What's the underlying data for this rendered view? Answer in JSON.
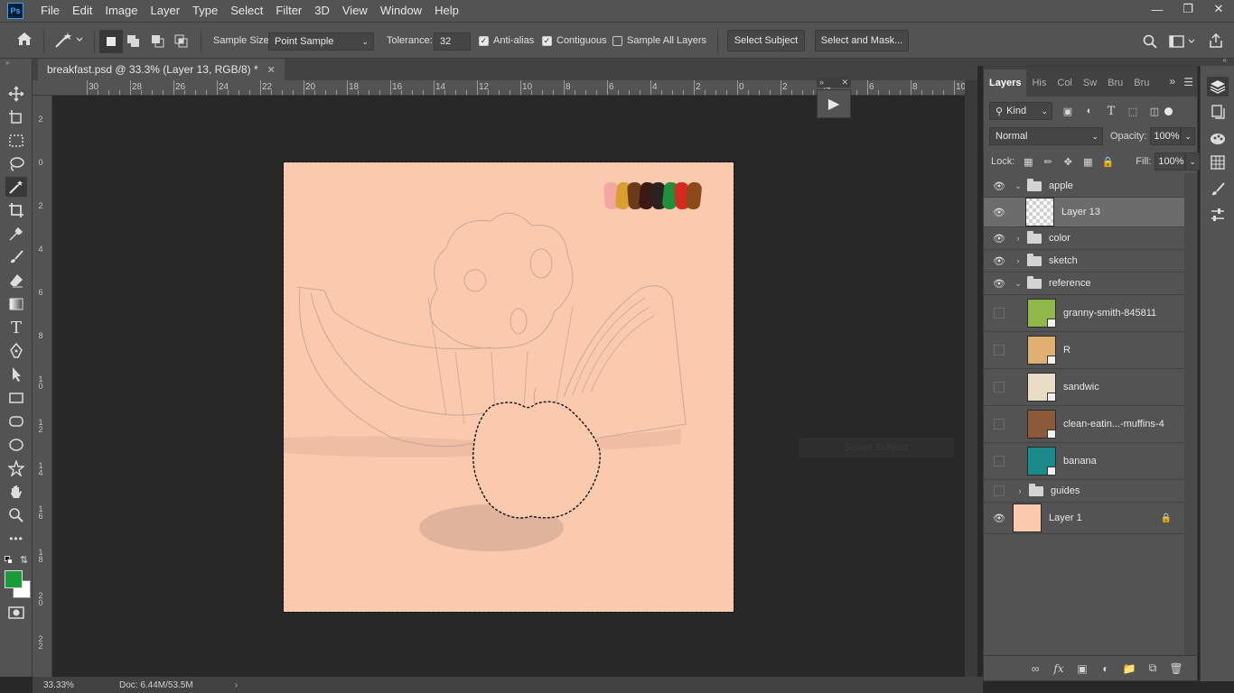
{
  "app": {
    "logo": "Ps",
    "menu": [
      "File",
      "Edit",
      "Image",
      "Layer",
      "Type",
      "Select",
      "Filter",
      "3D",
      "View",
      "Window",
      "Help"
    ],
    "window_controls": [
      "minimize-icon",
      "restore-icon",
      "close-icon"
    ]
  },
  "options": {
    "sample_size_label": "Sample Size:",
    "sample_size_value": "Point Sample",
    "tolerance_label": "Tolerance:",
    "tolerance_value": "32",
    "anti_alias": "Anti-alias",
    "contiguous": "Contiguous",
    "sample_all_layers": "Sample All Layers",
    "select_subject": "Select Subject",
    "select_and_mask": "Select and Mask...",
    "anti_alias_checked": true,
    "contiguous_checked": true,
    "sample_all_checked": false
  },
  "document": {
    "tab_title": "breakfast.psd @ 33.3% (Layer 13, RGB/8) *",
    "zoom": "33.33%",
    "doc_size": "Doc: 6.44M/53.5M"
  },
  "ruler": {
    "top": [
      "30",
      "28",
      "26",
      "24",
      "22",
      "20",
      "18",
      "16",
      "14",
      "12",
      "10",
      "8",
      "6",
      "4",
      "2",
      "0",
      "2",
      "4",
      "6",
      "8",
      "10"
    ],
    "left": [
      "2",
      "0",
      "2",
      "4",
      "6",
      "8",
      "1\n0",
      "1\n2",
      "1\n4",
      "1\n6",
      "1\n8",
      "2\n0",
      "2\n2"
    ]
  },
  "canvas": {
    "bg_color": "#fac9ae",
    "swatches": [
      "#f4a6a0",
      "#d9a030",
      "#6b3a1a",
      "#3a1a12",
      "#2a2222",
      "#1f8f3a",
      "#d42a1f",
      "#8a4a1a"
    ]
  },
  "ghost_tip": "Select Subject",
  "layers_panel": {
    "tabs": [
      "Layers",
      "His",
      "Col",
      "Sw",
      "Bru",
      "Bru"
    ],
    "kind_label": "Kind",
    "blend_mode": "Normal",
    "opacity_label": "Opacity:",
    "opacity_value": "100%",
    "lock_label": "Lock:",
    "fill_label": "Fill:",
    "fill_value": "100%",
    "layers": [
      {
        "name": "apple",
        "type": "group",
        "visible": true,
        "expanded": true,
        "indent": 0
      },
      {
        "name": "Layer 13",
        "type": "layer",
        "visible": true,
        "selected": true,
        "indent": 1
      },
      {
        "name": "color",
        "type": "group",
        "visible": true,
        "expanded": false,
        "indent": 0
      },
      {
        "name": "sketch",
        "type": "group",
        "visible": true,
        "expanded": false,
        "indent": 0
      },
      {
        "name": "reference",
        "type": "group",
        "visible": true,
        "expanded": true,
        "indent": 0
      },
      {
        "name": "granny-smith-845811",
        "type": "smart",
        "visible": false,
        "indent": 1,
        "thumb_color": "#8fb84a"
      },
      {
        "name": "R",
        "type": "smart",
        "visible": false,
        "indent": 1,
        "thumb_color": "#e0b070"
      },
      {
        "name": "sandwic",
        "type": "smart",
        "visible": false,
        "indent": 1,
        "thumb_color": "#e8dcc4"
      },
      {
        "name": "clean-eatin...-muffins-4",
        "type": "smart",
        "visible": false,
        "indent": 1,
        "thumb_color": "#8a5a3a"
      },
      {
        "name": "banana",
        "type": "smart",
        "visible": false,
        "indent": 1,
        "thumb_color": "#1a8a8a"
      },
      {
        "name": "guides",
        "type": "group",
        "visible": false,
        "expanded": false,
        "indent": 0
      },
      {
        "name": "Layer 1",
        "type": "layer",
        "visible": true,
        "locked": true,
        "indent": 0,
        "thumb_color": "#fac9ae"
      }
    ]
  },
  "colors": {
    "foreground": "#1a9a3a",
    "background": "#ffffff"
  }
}
